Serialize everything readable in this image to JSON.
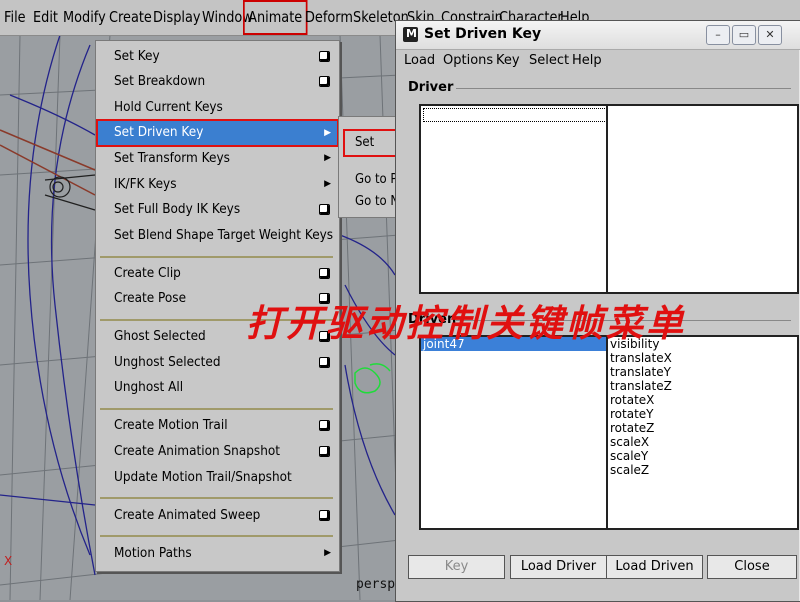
{
  "menubar": {
    "items": [
      "File",
      "Edit",
      "Modify",
      "Create",
      "Display",
      "Window",
      "Animate",
      "Deform",
      "Skeleton",
      "Skin",
      "Constrain",
      "Character",
      "Help"
    ],
    "active_item": "Animate"
  },
  "animate_menu": {
    "items": [
      {
        "label": "Set Key",
        "option_box": true,
        "submenu": false
      },
      {
        "label": "Set Breakdown",
        "option_box": true,
        "submenu": false
      },
      {
        "label": "Hold Current Keys",
        "option_box": false,
        "submenu": false
      },
      {
        "label": "Set Driven Key",
        "option_box": false,
        "submenu": true,
        "selected": true
      },
      {
        "label": "Set Transform Keys",
        "option_box": false,
        "submenu": true
      },
      {
        "label": "IK/FK Keys",
        "option_box": false,
        "submenu": true
      },
      {
        "label": "Set Full Body IK Keys",
        "option_box": true,
        "submenu": false
      },
      {
        "label": "Set Blend Shape Target Weight Keys",
        "option_box": false,
        "submenu": false
      },
      {
        "label": "Create Clip",
        "option_box": true,
        "submenu": false
      },
      {
        "label": "Create Pose",
        "option_box": true,
        "submenu": false
      },
      {
        "label": "Ghost Selected",
        "option_box": true,
        "submenu": false
      },
      {
        "label": "Unghost Selected",
        "option_box": true,
        "submenu": false
      },
      {
        "label": "Unghost All",
        "option_box": false,
        "submenu": false
      },
      {
        "label": "Create Motion Trail",
        "option_box": true,
        "submenu": false
      },
      {
        "label": "Create Animation Snapshot",
        "option_box": true,
        "submenu": false
      },
      {
        "label": "Update Motion Trail/Snapshot",
        "option_box": false,
        "submenu": false
      },
      {
        "label": "Create Animated Sweep",
        "option_box": true,
        "submenu": false
      },
      {
        "label": "Motion Paths",
        "option_box": false,
        "submenu": true
      }
    ]
  },
  "submenu": {
    "items": [
      "Set",
      "Go to Previous",
      "Go to Next"
    ]
  },
  "sdk_window": {
    "title": "Set Driven Key",
    "window_controls": [
      "–",
      "▭",
      "✕"
    ],
    "menu": [
      "Load",
      "Options",
      "Key",
      "Select",
      "Help"
    ],
    "driver_label": "Driver",
    "driven_label": "Driven",
    "driver_objects": [],
    "driver_attributes": [],
    "driven_objects": [
      {
        "label": "joint47",
        "selected": true
      }
    ],
    "driven_attributes": [
      "visibility",
      "translateX",
      "translateY",
      "translateZ",
      "rotateX",
      "rotateY",
      "rotateZ",
      "scaleX",
      "scaleY",
      "scaleZ"
    ],
    "buttons": {
      "key": "Key",
      "load_driver": "Load Driver",
      "load_driven": "Load Driven",
      "close": "Close"
    },
    "key_button_enabled": false
  },
  "viewport": {
    "camera_label": "persp",
    "axis_label": "X"
  },
  "annotation": "打开驱动控制关键帧菜单",
  "colors": {
    "highlight_blue": "#3b7fd0",
    "annotation_red": "#e01010",
    "menu_bg": "#c8c8c8"
  },
  "icons": {
    "option_box": "option-box-icon",
    "submenu_arrow": "submenu-arrow-icon",
    "app_icon": "maya-icon"
  }
}
